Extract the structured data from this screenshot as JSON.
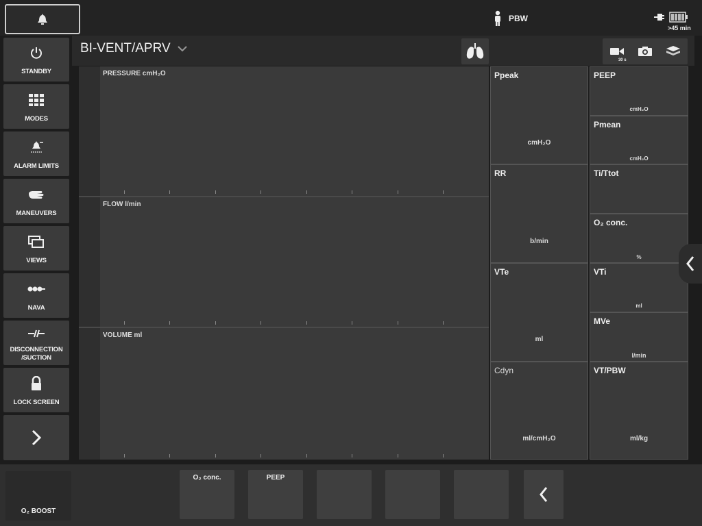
{
  "topbar": {
    "pbw_label": "PBW",
    "battery_text": ">45 min"
  },
  "sidebar": {
    "items": [
      {
        "label": "STANDBY",
        "icon": "power-icon"
      },
      {
        "label": "MODES",
        "icon": "grid-icon"
      },
      {
        "label": "ALARM LIMITS",
        "icon": "alarm-limits-icon"
      },
      {
        "label": "MANEUVERS",
        "icon": "hand-icon"
      },
      {
        "label": "VIEWS",
        "icon": "views-icon"
      },
      {
        "label": "NAVA",
        "icon": "nava-icon"
      },
      {
        "label": "DISCONNECTION /SUCTION",
        "icon": "disconnection-icon"
      },
      {
        "label": "LOCK SCREEN",
        "icon": "lock-icon"
      }
    ]
  },
  "mode": {
    "title": "BI-VENT/APRV"
  },
  "media": {
    "video_badge": "30 s"
  },
  "waveforms": [
    {
      "title": "PRESSURE cmH₂O"
    },
    {
      "title": "FLOW l/min"
    },
    {
      "title": "VOLUME ml"
    }
  ],
  "params": {
    "ppeak": {
      "name": "Ppeak",
      "unit": "cmH₂O"
    },
    "rr": {
      "name": "RR",
      "unit": "b/min"
    },
    "vte": {
      "name": "VTe",
      "unit": "ml"
    },
    "cdyn": {
      "name": "Cdyn",
      "unit": "ml/cmH₂O"
    },
    "peep": {
      "name": "PEEP",
      "unit": "cmH₂O"
    },
    "pmean": {
      "name": "Pmean",
      "unit": "cmH₂O"
    },
    "ti_ttot": {
      "name": "Ti/Ttot",
      "unit": ""
    },
    "o2": {
      "name": "O₂ conc.",
      "unit": "%"
    },
    "vti": {
      "name": "VTi",
      "unit": "ml"
    },
    "mve": {
      "name": "MVe",
      "unit": "l/min"
    },
    "vt_pbw": {
      "name": "VT/PBW",
      "unit": "ml/kg"
    }
  },
  "bottombar": {
    "o2_boost": "O₂ BOOST",
    "quick_settings": [
      "O₂ conc.",
      "PEEP",
      "",
      "",
      ""
    ]
  }
}
